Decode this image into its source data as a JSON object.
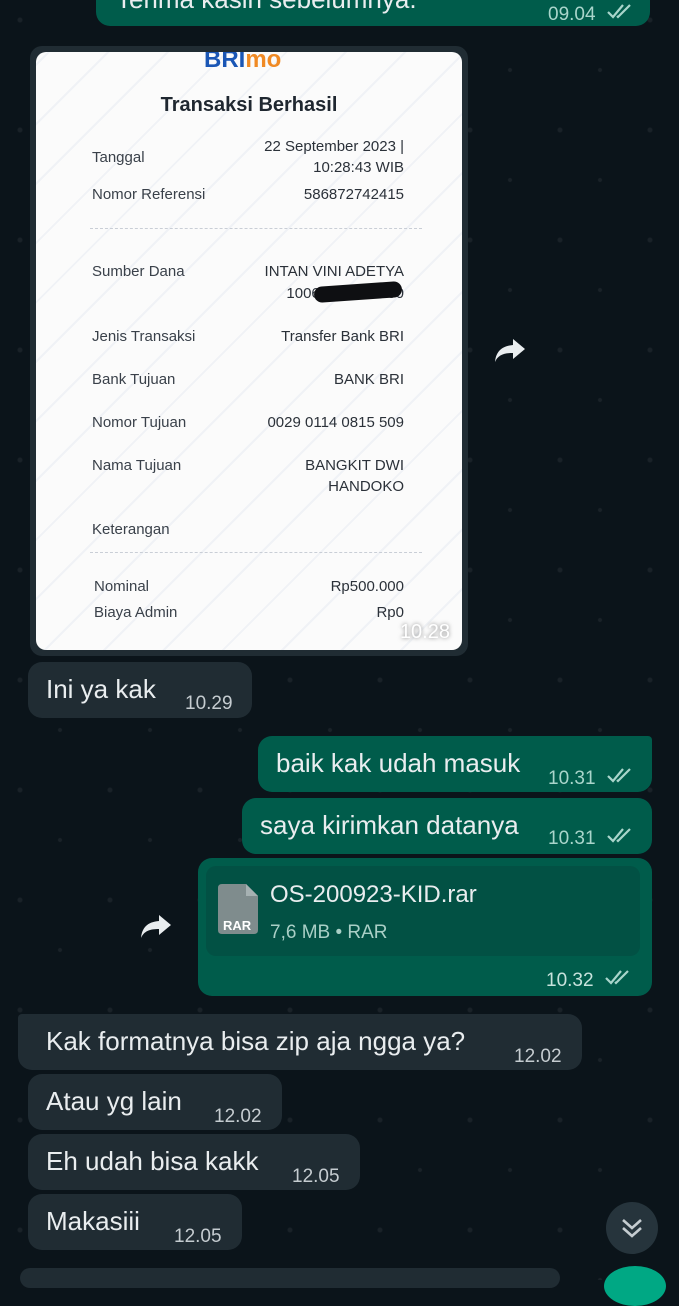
{
  "messages": {
    "top_out": {
      "text": "Terima kasih sebelumnya.",
      "time": "09.04"
    },
    "image_time": "10.28",
    "m1": {
      "text": "Ini ya kak",
      "time": "10.29"
    },
    "m2": {
      "text": "baik kak udah masuk",
      "time": "10.31"
    },
    "m3": {
      "text": "saya kirimkan datanya",
      "time": "10.31"
    },
    "file": {
      "icon_label": "RAR",
      "name": "OS-200923-KID.rar",
      "meta": "7,6 MB • RAR",
      "time": "10.32"
    },
    "m4": {
      "text": "Kak formatnya bisa zip aja ngga ya?",
      "time": "12.02"
    },
    "m5": {
      "text": "Atau yg lain",
      "time": "12.02"
    },
    "m6": {
      "text": "Eh udah bisa kakk",
      "time": "12.05"
    },
    "m7": {
      "text": "Makasiii",
      "time": "12.05"
    }
  },
  "receipt": {
    "logo_main": "BRI",
    "logo_suffix": "mo",
    "title": "Transaksi Berhasil",
    "tanggal_label": "Tanggal",
    "tanggal_value_1": "22 September 2023 |",
    "tanggal_value_2": "10:28:43 WIB",
    "ref_label": "Nomor Referensi",
    "ref_value": "586872742415",
    "sumber_label": "Sumber Dana",
    "sumber_value_1": "INTAN VINI ADETYA",
    "sumber_value_2": "1006 **** **** 500",
    "jenis_label": "Jenis Transaksi",
    "jenis_value": "Transfer Bank BRI",
    "bank_label": "Bank Tujuan",
    "bank_value": "BANK BRI",
    "nomor_tujuan_label": "Nomor Tujuan",
    "nomor_tujuan_value": "0029 0114 0815 509",
    "nama_label": "Nama Tujuan",
    "nama_value_1": "BANGKIT DWI",
    "nama_value_2": "HANDOKO",
    "ket_label": "Keterangan",
    "nominal_label": "Nominal",
    "nominal_value": "Rp500.000",
    "biaya_label": "Biaya Admin",
    "biaya_value": "Rp0"
  },
  "icons": {
    "forward": "forward-arrow-icon",
    "ticks": "double-check-icon",
    "scroll": "chevron-double-down-icon"
  },
  "colors": {
    "background": "#0b141a",
    "incoming_bubble": "#202c33",
    "outgoing_bubble": "#005c4b",
    "accent": "#00a884"
  }
}
